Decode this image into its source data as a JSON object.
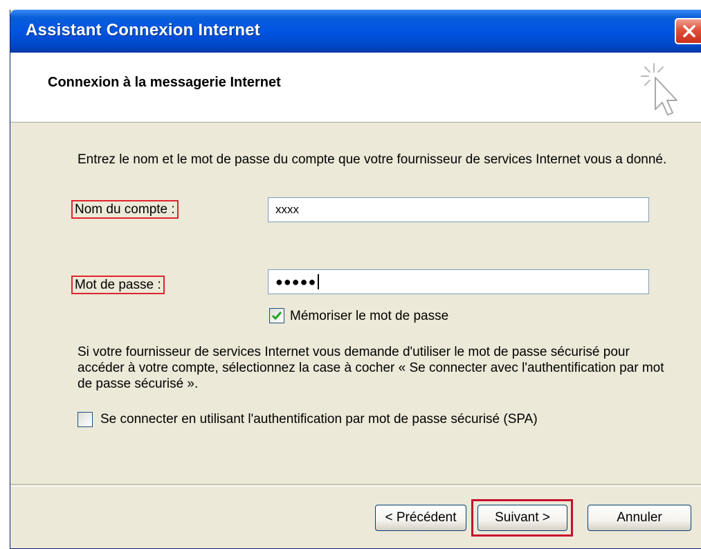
{
  "window": {
    "title": "Assistant Connexion Internet",
    "close_icon": "close-icon"
  },
  "header": {
    "heading": "Connexion à la messagerie Internet",
    "wizard_icon": "wizard-cursor-icon"
  },
  "form": {
    "intro": "Entrez le nom et le mot de passe du compte que votre fournisseur de services Internet vous a donné.",
    "account_label": "Nom du compte :",
    "account_value": "xxxx",
    "password_label": "Mot de passe :",
    "password_value": "●●●●●",
    "remember_label": "Mémoriser le mot de passe",
    "remember_checked": true,
    "spa_info": "Si votre fournisseur de services Internet vous demande d'utiliser le mot de passe sécurisé pour accéder à votre compte, sélectionnez la case à cocher « Se connecter avec l'authentification par mot de passe sécurisé ».",
    "spa_label": "Se connecter en utilisant l'authentification par mot de passe sécurisé (SPA)",
    "spa_checked": false
  },
  "buttons": {
    "previous": "< Précédent",
    "next": "Suivant >",
    "cancel": "Annuler"
  },
  "colors": {
    "titlebar": "#0054e3",
    "dialog_bg": "#ece9d8",
    "highlight": "#e0232e"
  }
}
